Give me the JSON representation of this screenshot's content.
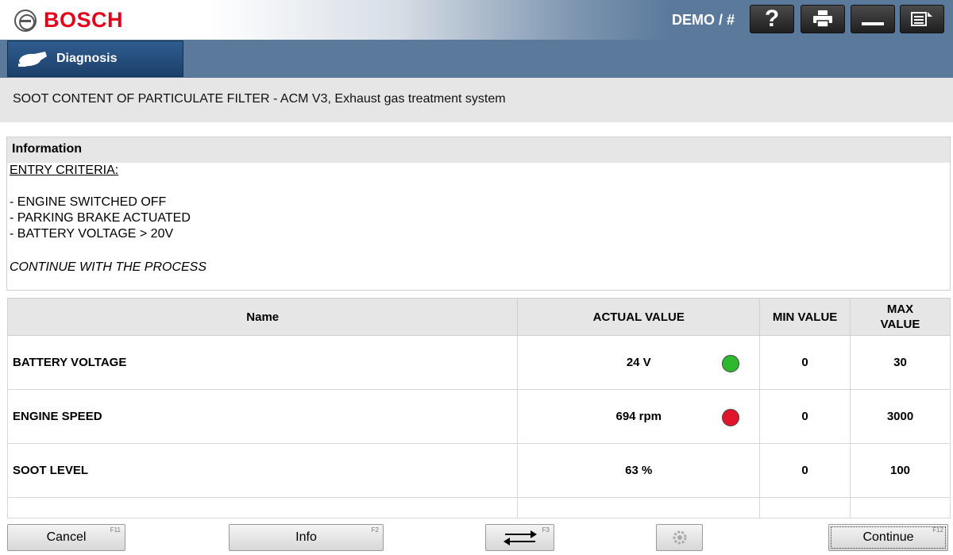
{
  "header": {
    "brand": "BOSCH",
    "user": "DEMO / #",
    "toolbar_icons": [
      "help-icon",
      "print-icon",
      "minimize-icon",
      "menu-icon"
    ]
  },
  "tabs": {
    "active": "Diagnosis",
    "icon": "diagnosis-plug-icon"
  },
  "page": {
    "title": "SOOT CONTENT OF PARTICULATE FILTER - ACM V3, Exhaust gas treatment system"
  },
  "info": {
    "heading": "Information",
    "entry_title": "ENTRY CRITERIA:",
    "criteria": [
      "- ENGINE SWITCHED OFF",
      "- PARKING BRAKE ACTUATED",
      "- BATTERY VOLTAGE > 20V"
    ],
    "instruction": "CONTINUE WITH THE PROCESS"
  },
  "table": {
    "columns": {
      "name": "Name",
      "actual": "ACTUAL VALUE",
      "min": "MIN VALUE",
      "max_line1": "MAX",
      "max_line2": "VALUE"
    },
    "rows": [
      {
        "name": "BATTERY VOLTAGE",
        "actual": "24 V",
        "min": "0",
        "max": "30",
        "status": "ok",
        "status_color": "#2eb82e"
      },
      {
        "name": "ENGINE SPEED",
        "actual": "694 rpm",
        "min": "0",
        "max": "3000",
        "status": "fault",
        "status_color": "#e0142a"
      },
      {
        "name": "SOOT LEVEL",
        "actual": "63 %",
        "min": "0",
        "max": "100",
        "status": "none"
      }
    ]
  },
  "footer": {
    "cancel": "Cancel",
    "cancel_key": "F11",
    "info": "Info",
    "info_key": "F2",
    "swap_key": "F3",
    "swap_icon": "swap-arrows-icon",
    "gear_icon": "gear-icon",
    "continue": "Continue",
    "continue_key": "F12"
  },
  "colors": {
    "brand_red": "#e2001a",
    "header_blue": "#5b7a9b",
    "tab_blue": "#1c3f6a",
    "ok_green": "#2eb82e",
    "fault_red": "#e0142a"
  }
}
